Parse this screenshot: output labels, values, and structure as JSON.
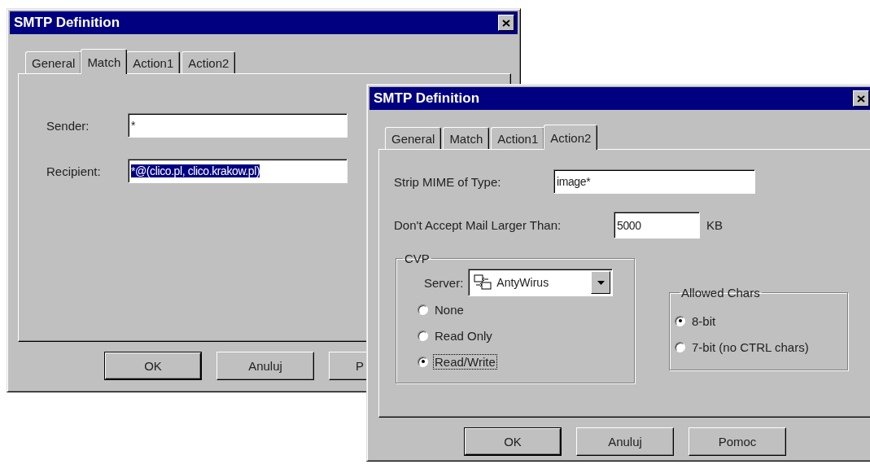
{
  "windows": [
    {
      "kind": "match",
      "title": "SMTP Definition",
      "tabs": [
        {
          "label": "General",
          "selected": false
        },
        {
          "label": "Match",
          "selected": true
        },
        {
          "label": "Action1",
          "selected": false
        },
        {
          "label": "Action2",
          "selected": false
        }
      ],
      "fields": [
        {
          "label": "Sender:",
          "value": "*",
          "selected": false
        },
        {
          "label": "Recipient:",
          "value": "*@(clico.pl, clico.krakow.pl)",
          "selected": true
        }
      ],
      "buttons": [
        {
          "label": "OK",
          "default": true
        },
        {
          "label": "Anuluj",
          "default": false
        },
        {
          "label": "P",
          "default": false
        }
      ]
    },
    {
      "kind": "action2",
      "title": "SMTP Definition",
      "tabs": [
        {
          "label": "General",
          "selected": false
        },
        {
          "label": "Match",
          "selected": false
        },
        {
          "label": "Action1",
          "selected": false
        },
        {
          "label": "Action2",
          "selected": true
        }
      ],
      "strip_mime": {
        "label": "Strip MIME of Type:",
        "value": "image*"
      },
      "max_size": {
        "label": "Don't Accept Mail Larger Than:",
        "value": "5000",
        "unit": "KB"
      },
      "cvp": {
        "title": "CVP",
        "server_label": "Server:",
        "server": "AntyWirus",
        "options": [
          {
            "label": "None",
            "selected": false,
            "focused": false
          },
          {
            "label": "Read Only",
            "selected": false,
            "focused": false
          },
          {
            "label": "Read/Write",
            "selected": true,
            "focused": true
          }
        ]
      },
      "allowed_chars": {
        "title": "Allowed Chars",
        "options": [
          {
            "label": "8-bit",
            "selected": true,
            "focused": false
          },
          {
            "label": "7-bit (no CTRL chars)",
            "selected": false,
            "focused": false
          }
        ]
      },
      "buttons": [
        {
          "label": "OK",
          "default": true
        },
        {
          "label": "Anuluj",
          "default": false
        },
        {
          "label": "Pomoc",
          "default": false
        }
      ]
    }
  ]
}
